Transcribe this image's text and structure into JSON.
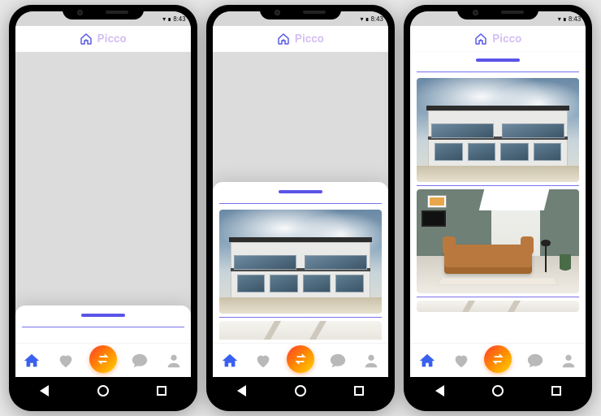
{
  "status_bar": {
    "time": "8:43",
    "battery_icon": "battery-icon",
    "signal_icon": "signal-icon"
  },
  "app": {
    "name": "Picco",
    "logo_icon": "house-icon",
    "accent_color": "#5a54e8",
    "title_color": "#d4bdf2"
  },
  "bottom_nav": {
    "items": [
      {
        "name": "home",
        "icon": "home-icon",
        "active": true
      },
      {
        "name": "likes",
        "icon": "heart-icon",
        "active": false
      },
      {
        "name": "swap",
        "icon": "swap-icon",
        "active": false,
        "center": true
      },
      {
        "name": "chat",
        "icon": "chat-icon",
        "active": false
      },
      {
        "name": "profile",
        "icon": "person-icon",
        "active": false
      }
    ]
  },
  "system_nav": {
    "back": "back-button",
    "home": "home-button",
    "recents": "recents-button"
  },
  "screens": [
    {
      "sheet_state": "collapsed",
      "visible_cards": []
    },
    {
      "sheet_state": "half",
      "visible_cards": [
        "modern-house-exterior",
        "interior-ceiling-partial"
      ]
    },
    {
      "sheet_state": "full",
      "visible_cards": [
        "modern-house-exterior",
        "living-room-interior",
        "interior-partial"
      ]
    }
  ],
  "feed": {
    "cards": [
      {
        "id": "modern-house-exterior",
        "alt": "Modern two-story white house with dark roof and glass balconies against cloudy sky"
      },
      {
        "id": "living-room-interior",
        "alt": "Living room with tan leather sofa, green accent walls, floor lamp and plant"
      },
      {
        "id": "interior-partial",
        "alt": "Partial view of bright interior ceiling"
      }
    ]
  }
}
